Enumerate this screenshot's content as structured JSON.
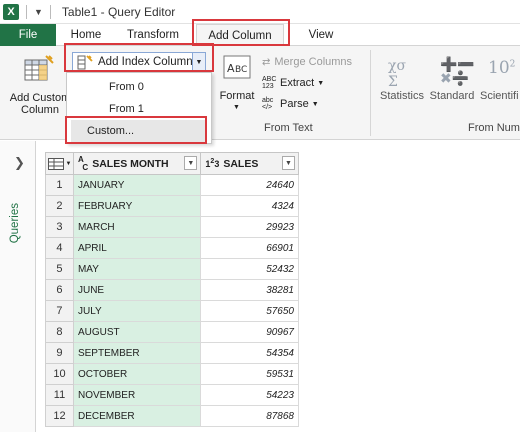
{
  "window": {
    "title": "Table1 - Query Editor"
  },
  "tabs": [
    {
      "label": "File"
    },
    {
      "label": "Home"
    },
    {
      "label": "Transform"
    },
    {
      "label": "Add Column"
    },
    {
      "label": "View"
    }
  ],
  "ribbon": {
    "add_custom_column": [
      "Add Custom",
      "Column"
    ],
    "add_index_column": "Add Index Column",
    "index_menu": [
      "From 0",
      "From 1",
      "Custom..."
    ],
    "format": "Format",
    "merge_columns": "Merge Columns",
    "extract": "Extract",
    "parse": "Parse",
    "group_from_text": "From Text",
    "statistics": "Statistics",
    "standard": "Standard",
    "scientific": "Scientifi",
    "group_from_number": "From Num"
  },
  "queries_pane": {
    "label": "Queries"
  },
  "grid": {
    "columns": [
      {
        "name": "SALES MONTH",
        "type": "text"
      },
      {
        "name": "SALES",
        "type": "number"
      }
    ],
    "rows": [
      {
        "n": "1",
        "month": "JANUARY",
        "sales": "24640"
      },
      {
        "n": "2",
        "month": "FEBRUARY",
        "sales": "4324"
      },
      {
        "n": "3",
        "month": "MARCH",
        "sales": "29923"
      },
      {
        "n": "4",
        "month": "APRIL",
        "sales": "66901"
      },
      {
        "n": "5",
        "month": "MAY",
        "sales": "52432"
      },
      {
        "n": "6",
        "month": "JUNE",
        "sales": "38281"
      },
      {
        "n": "7",
        "month": "JULY",
        "sales": "57650"
      },
      {
        "n": "8",
        "month": "AUGUST",
        "sales": "90967"
      },
      {
        "n": "9",
        "month": "SEPTEMBER",
        "sales": "54354"
      },
      {
        "n": "10",
        "month": "OCTOBER",
        "sales": "59531"
      },
      {
        "n": "11",
        "month": "NOVEMBER",
        "sales": "54223"
      },
      {
        "n": "12",
        "month": "DECEMBER",
        "sales": "87868"
      }
    ]
  },
  "colors": {
    "excel_green": "#217346",
    "highlight_red": "#d9383d",
    "text_column_fill": "#d9f0e2"
  }
}
